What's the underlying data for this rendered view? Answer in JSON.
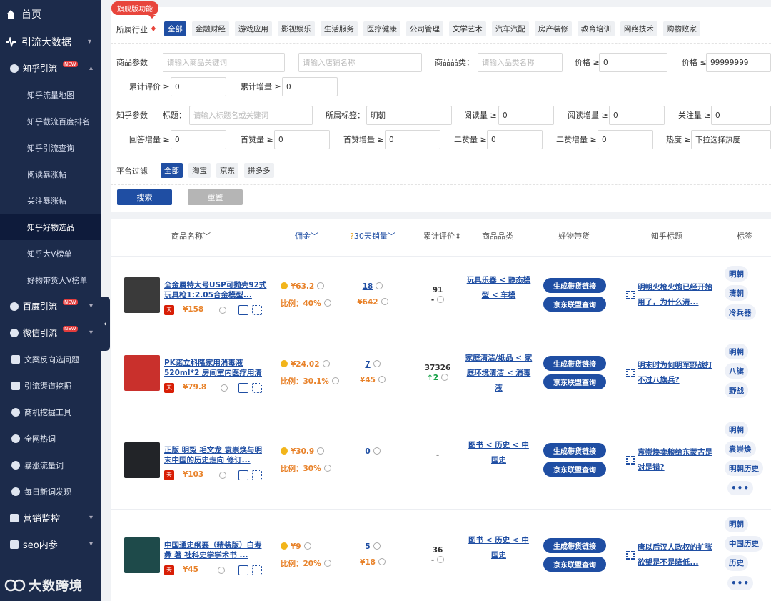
{
  "sidebar": {
    "home": "首页",
    "traffic_data": "引流大数据",
    "zhihu_group": "知乎引流",
    "new_badge": "NEW",
    "sub_items": [
      "知乎流量地图",
      "知乎截流百度排名",
      "知乎引流查询",
      "阅读暴涨帖",
      "关注暴涨帖",
      "知乎好物选品",
      "知乎大V榜单",
      "好物带货大V榜单"
    ],
    "groups": [
      {
        "label": "百度引流",
        "new": true
      },
      {
        "label": "微信引流",
        "new": true
      }
    ],
    "mid_items": [
      "文案反向选问题",
      "引流渠道挖掘",
      "商机挖掘工具",
      "全网热词",
      "暴涨流量词",
      "每日新词发现"
    ],
    "marketing": "营销监控",
    "seo": "seo内参",
    "watermark": "大数跨境"
  },
  "filters": {
    "promo": "旗舰版功能",
    "industry_label": "所属行业",
    "industries": [
      "全部",
      "金融财经",
      "游戏应用",
      "影视娱乐",
      "生活服务",
      "医疗健康",
      "公司管理",
      "文学艺术",
      "汽车汽配",
      "房产装修",
      "教育培训",
      "网络技术",
      "购物败家"
    ],
    "product_param_label": "商品参数",
    "product_name_ph": "请输入商品关键词",
    "store_name_ph": "请输入店铺名称",
    "category_label": "商品品类：",
    "category_ph": "请输入品类名称",
    "price_min_label": "价格 ≥",
    "price_min": "0",
    "price_max_label": "价格 ≤",
    "price_max": "99999999",
    "total_eval_label": "累计评价 ≥",
    "total_eval": "0",
    "total_inc_label": "累计增量 ≥",
    "total_inc": "0",
    "zhihu_param_label": "知乎参数",
    "title_label": "标题：",
    "title_ph": "请输入标题名或关键词",
    "tag_label": "所属标签：",
    "tag_value": "明朝",
    "read_label": "阅读量 ≥",
    "read_value": "0",
    "read_inc_label": "阅读增量 ≥",
    "read_inc": "0",
    "follow_label": "关注量 ≥",
    "follow_value": "0",
    "answer_inc_label": "回答增量 ≥",
    "answer_inc": "0",
    "first_like_label": "首赞量 ≥",
    "first_like": "0",
    "first_like_inc_label": "首赞增量 ≥",
    "first_like_inc": "0",
    "second_like_label": "二赞量 ≥",
    "second_like": "0",
    "second_like_inc_label": "二赞增量 ≥",
    "second_like_inc": "0",
    "heat_label": "热度 ≥",
    "heat_ph": "下拉选择热度",
    "platform_label": "平台过滤",
    "platforms": [
      "全部",
      "淘宝",
      "京东",
      "拼多多"
    ],
    "search_btn": "搜索",
    "reset_btn": "重置"
  },
  "table": {
    "headers": [
      "商品名称",
      "佣金",
      "30天销量",
      "累计评价",
      "商品品类",
      "好物带货",
      "知乎标题",
      "标签"
    ],
    "gen_link": "生成带货链接",
    "jd_query": "京东联盟查询",
    "rows": [
      {
        "name": "全金属特大号USP可抛壳92式玩具枪1:2.05合金模型...",
        "price": "¥158",
        "commission": "¥63.2",
        "ratio": "比例：40%",
        "sales": "18",
        "sales_money": "¥642",
        "eval": "91",
        "eval_inc": "-",
        "category": "玩具乐器 < 静态模型 < 车模",
        "ztitle": "明朝火枪火炮已经开始用了，为什么清...",
        "tags": [
          "明朝",
          "清朝",
          "冷兵器"
        ],
        "more": false,
        "thumb": "#3a3a3a"
      },
      {
        "name": "PK诺立科隆家用消毒液520ml*2 房间室内医疗用清洁...",
        "price": "¥79.8",
        "commission": "¥24.02",
        "ratio": "比例：30.1%",
        "sales": "7",
        "sales_money": "¥45",
        "eval": "37326",
        "eval_inc": "2",
        "category": "家庭清洁/纸品 < 家庭环境清洁 < 消毒液",
        "ztitle": "明末时为何明军野战打不过八旗兵?",
        "tags": [
          "明朝",
          "八旗",
          "野战"
        ],
        "more": false,
        "thumb": "#c9302c"
      },
      {
        "name": "正版 明冤 毛文龙 袁崇焕与明末中国的历史走向 修订...",
        "price": "¥103",
        "commission": "¥30.9",
        "ratio": "比例：30%",
        "sales": "0",
        "sales_money": "",
        "eval": "-",
        "eval_inc": "",
        "category": "图书 < 历史 < 中国史",
        "ztitle": "袁崇焕卖粮给东蒙古是对是错?",
        "tags": [
          "明朝",
          "袁崇焕",
          "明朝历史"
        ],
        "more": true,
        "thumb": "#222428"
      },
      {
        "name": "中国通史纲要（精装版）白寿彝 著 社科史学学术书 ...",
        "price": "¥45",
        "commission": "¥9",
        "ratio": "比例：20%",
        "sales": "5",
        "sales_money": "¥18",
        "eval": "36",
        "eval_inc": "-",
        "category": "图书 < 历史 < 中国史",
        "ztitle": "唐以后汉人政权的扩张欲望是不是降低...",
        "tags": [
          "明朝",
          "中国历史",
          "历史"
        ],
        "more": true,
        "thumb": "#1e4a4a"
      }
    ]
  }
}
